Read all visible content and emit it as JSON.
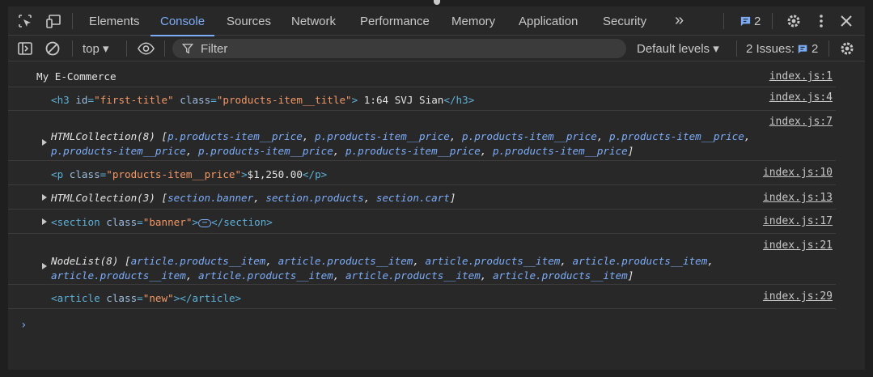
{
  "tabs": {
    "items": [
      "Elements",
      "Console",
      "Sources",
      "Network",
      "Performance",
      "Memory",
      "Application",
      "Security"
    ],
    "active": "Console",
    "more_label": "»",
    "messages_badge_count": "2"
  },
  "toolbar": {
    "context": "top ▾",
    "filter_placeholder": "Filter",
    "default_levels": "Default levels ▾",
    "issues_label": "2 Issues:",
    "issues_count": "2"
  },
  "console": {
    "log1": {
      "text": "My E-Commerce",
      "source": "index.js:1"
    },
    "log2": {
      "tag_open": "<h3 ",
      "a1": "id",
      "v1": "\"first-title\"",
      "a2": "class",
      "v2": "\"products-item__title\"",
      "tag_close": ">",
      "content": " 1:64 SVJ Sian",
      "tag_end": "</h3>",
      "source": "index.js:4"
    },
    "log3": {
      "head": "HTMLCollection(8) [",
      "line1_items": [
        "p.products-item__price",
        "p.products-item__price",
        "p.products-item__price",
        "p.products-item__price"
      ],
      "line2_items": [
        "p.products-item__price",
        "p.products-item__price",
        "p.products-item__price",
        "p.products-item__price"
      ],
      "source": "index.js:7"
    },
    "log4": {
      "tag_open": "<p ",
      "a1": "class",
      "v1": "\"products-item__price\"",
      "tag_close": ">",
      "content": "$1,250.00",
      "tag_end": "</p>",
      "source": "index.js:10"
    },
    "log5": {
      "head": "HTMLCollection(3) [",
      "items": [
        "section.banner",
        "section.products",
        "section.cart"
      ],
      "source": "index.js:13"
    },
    "log6": {
      "tag_open": "<section ",
      "a1": "class",
      "v1": "\"banner\"",
      "tag_close": ">",
      "ellipsis": "⋯",
      "tag_end": "</section>",
      "source": "index.js:17"
    },
    "log7": {
      "head": "NodeList(8) [",
      "line1_items": [
        "article.products__item",
        "article.products__item",
        "article.products__item",
        "article.products__item"
      ],
      "line2_items": [
        "article.products__item",
        "article.products__item",
        "article.products__item",
        "article.products__item"
      ],
      "source": "index.js:21"
    },
    "log8": {
      "tag_open": "<article ",
      "a1": "class",
      "v1": "\"new\"",
      "tag_close": ">",
      "tag_end": "</article>",
      "source": "index.js:29"
    },
    "prompt": "›"
  }
}
